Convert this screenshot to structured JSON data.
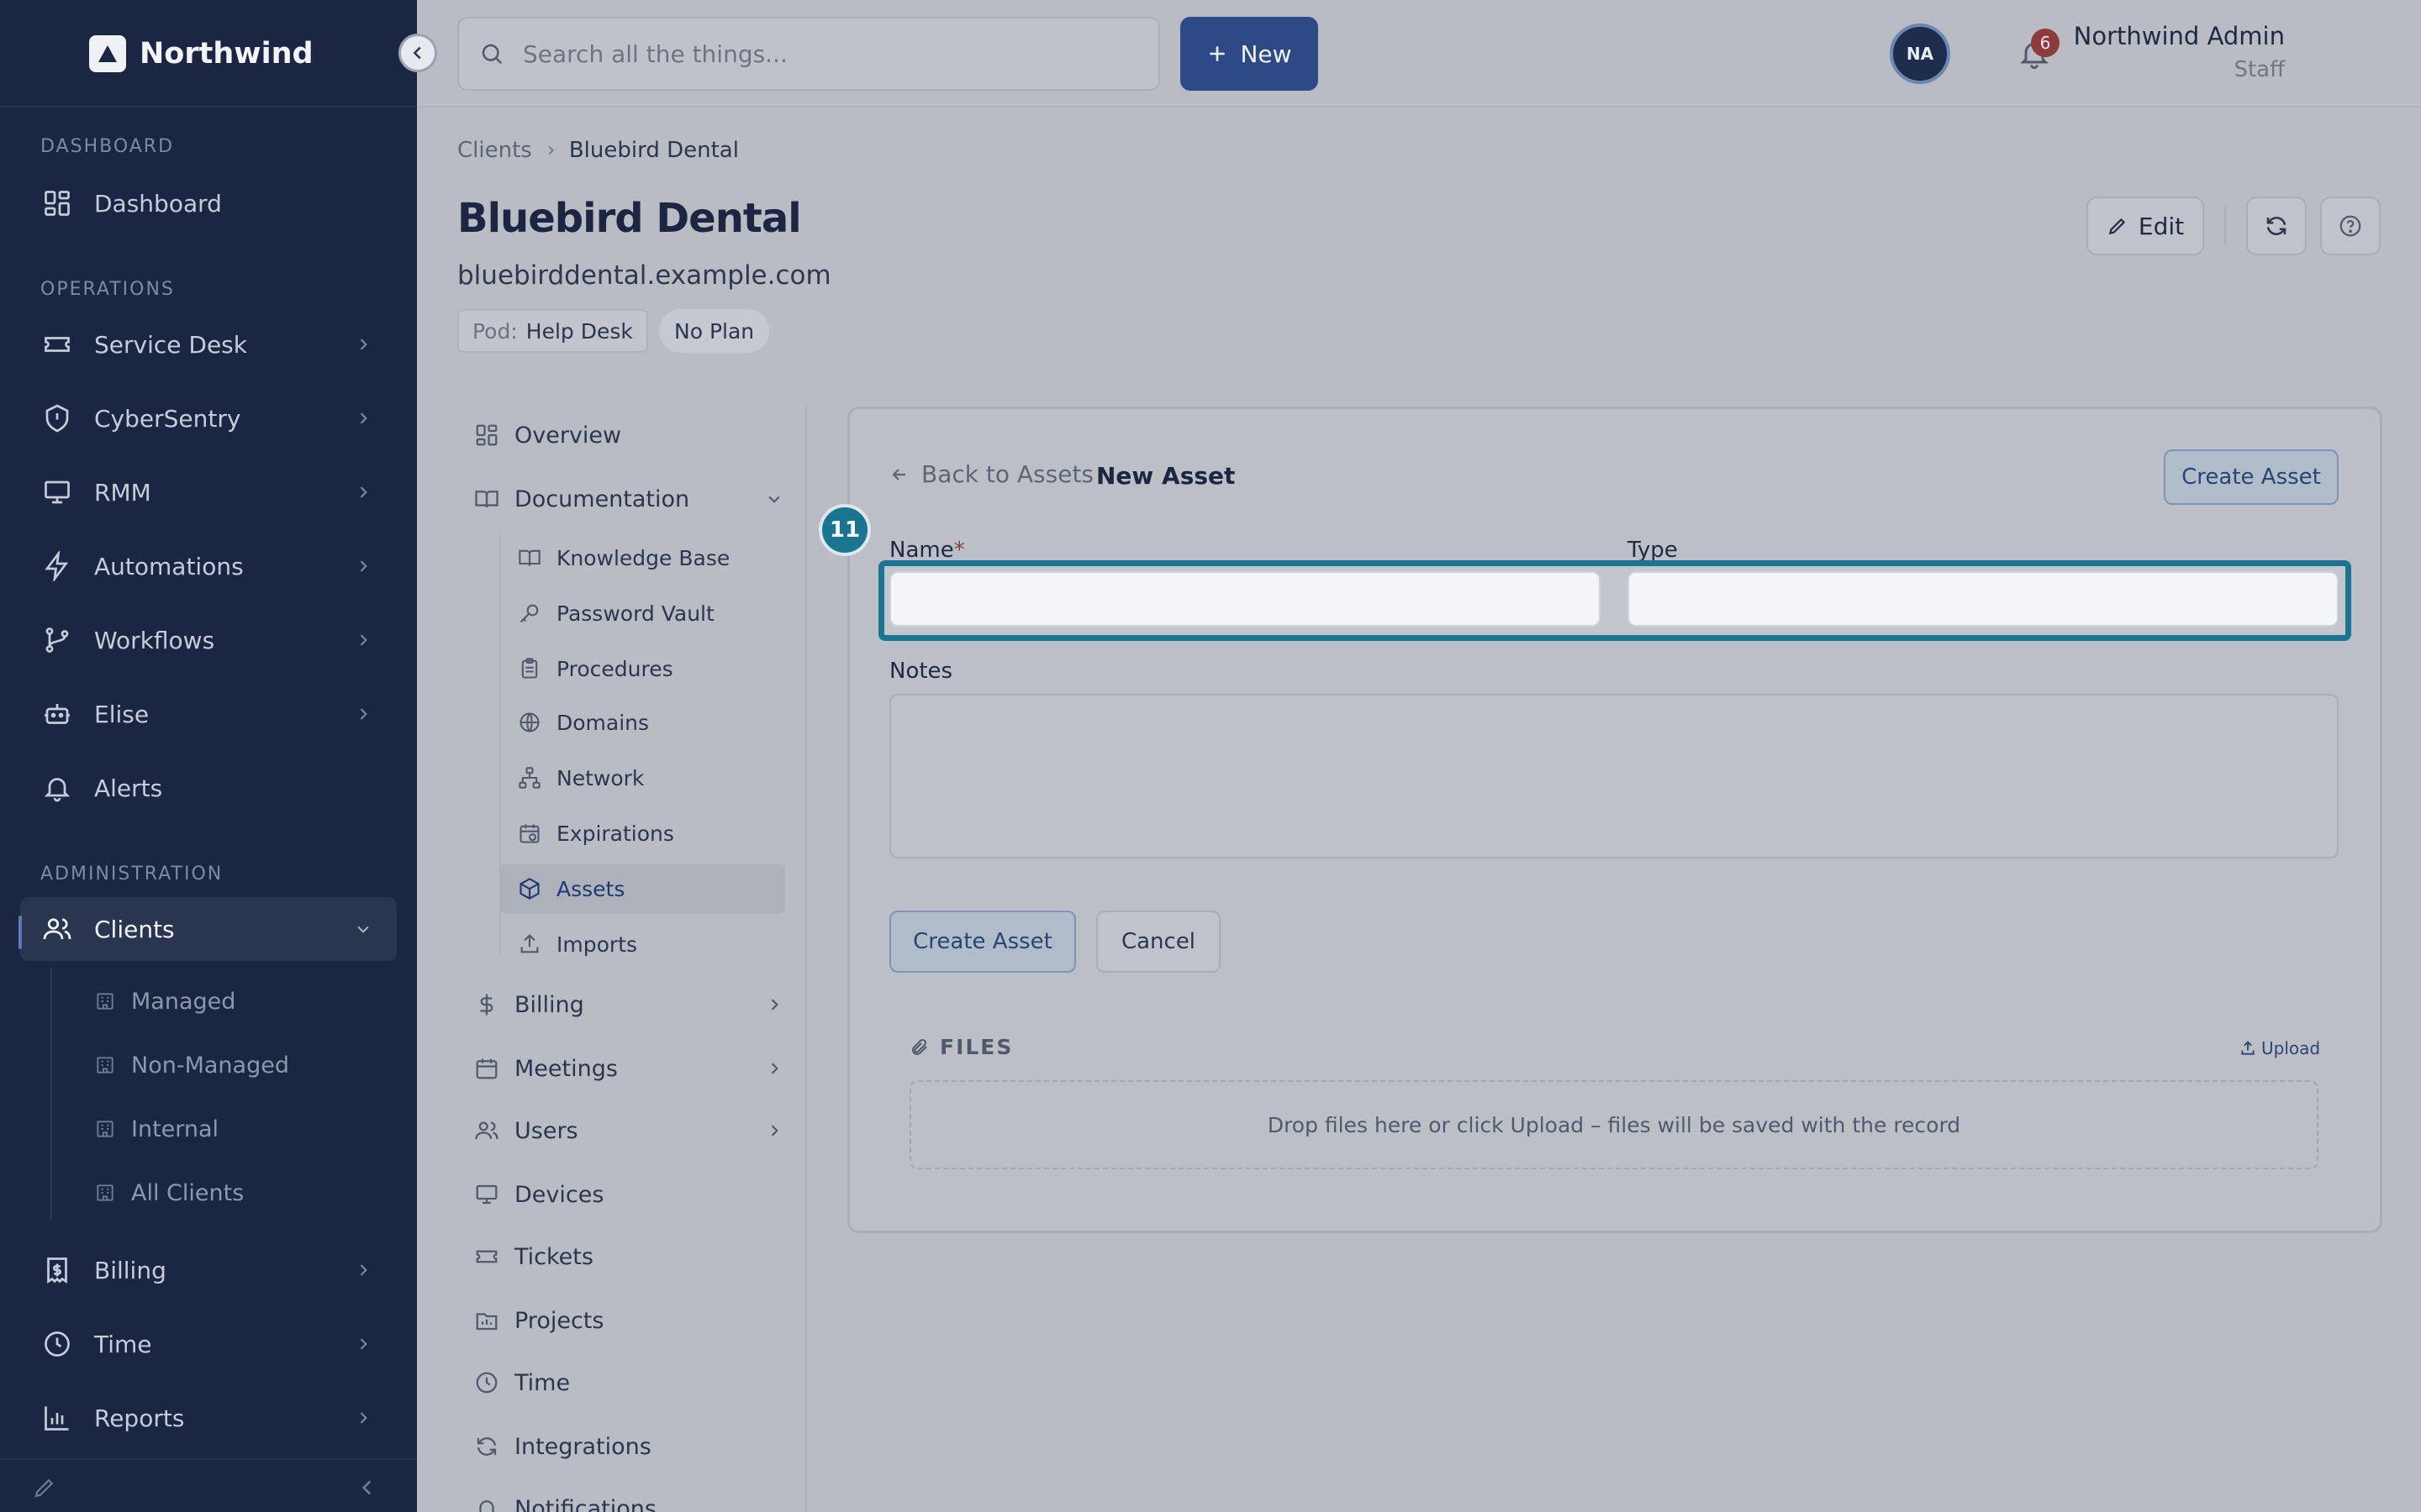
{
  "brand": {
    "name": "Northwind"
  },
  "sidebar": {
    "sections": {
      "dashboard": "DASHBOARD",
      "operations": "OPERATIONS",
      "administration": "ADMINISTRATION"
    },
    "items": [
      {
        "label": "Dashboard",
        "icon": "grid-icon"
      },
      {
        "label": "Service Desk",
        "icon": "ticket-icon"
      },
      {
        "label": "CyberSentry",
        "icon": "shield-icon"
      },
      {
        "label": "RMM",
        "icon": "monitor-icon"
      },
      {
        "label": "Automations",
        "icon": "bolt-icon"
      },
      {
        "label": "Workflows",
        "icon": "branch-icon"
      },
      {
        "label": "Elise",
        "icon": "robot-icon"
      },
      {
        "label": "Alerts",
        "icon": "bell-icon"
      },
      {
        "label": "Clients",
        "icon": "users-icon"
      },
      {
        "label": "Billing",
        "icon": "receipt-icon"
      },
      {
        "label": "Time",
        "icon": "clock-icon"
      },
      {
        "label": "Reports",
        "icon": "chart-icon"
      }
    ],
    "client_children": [
      "Managed",
      "Non-Managed",
      "Internal",
      "All Clients"
    ]
  },
  "topbar": {
    "search_placeholder": "Search all the things...",
    "new_label": "New",
    "notification_count": "6",
    "user_name": "Northwind Admin",
    "user_role": "Staff",
    "avatar_initials": "NA"
  },
  "header": {
    "breadcrumb": [
      "Clients",
      "Bluebird Dental"
    ],
    "title": "Bluebird Dental",
    "domain": "bluebirddental.example.com",
    "pod_key": "Pod:",
    "pod_value": "Help Desk",
    "plan": "No Plan",
    "edit_label": "Edit"
  },
  "subnav": {
    "items": [
      "Overview",
      "Documentation",
      "Billing",
      "Meetings",
      "Users",
      "Devices",
      "Tickets",
      "Projects",
      "Time",
      "Integrations",
      "Notifications"
    ],
    "documentation_children": [
      "Knowledge Base",
      "Password Vault",
      "Procedures",
      "Domains",
      "Network",
      "Expirations",
      "Assets",
      "Imports"
    ]
  },
  "form": {
    "back_label": "Back to Assets",
    "title": "New Asset",
    "create_top_label": "Create Asset",
    "name_label": "Name",
    "required_mark": "*",
    "type_label": "Type",
    "notes_label": "Notes",
    "name_value": "",
    "type_value": "",
    "notes_value": "",
    "create_label": "Create Asset",
    "cancel_label": "Cancel",
    "files_heading": "FILES",
    "upload_label": "Upload",
    "dropzone_text": "Drop files here or click Upload – files will be saved with the record",
    "step_badge": "11"
  },
  "colors": {
    "sidebar_bg": "#1b2742",
    "accent": "#2e4a86",
    "highlight": "#1a7591",
    "badge": "#8e3b3b"
  }
}
